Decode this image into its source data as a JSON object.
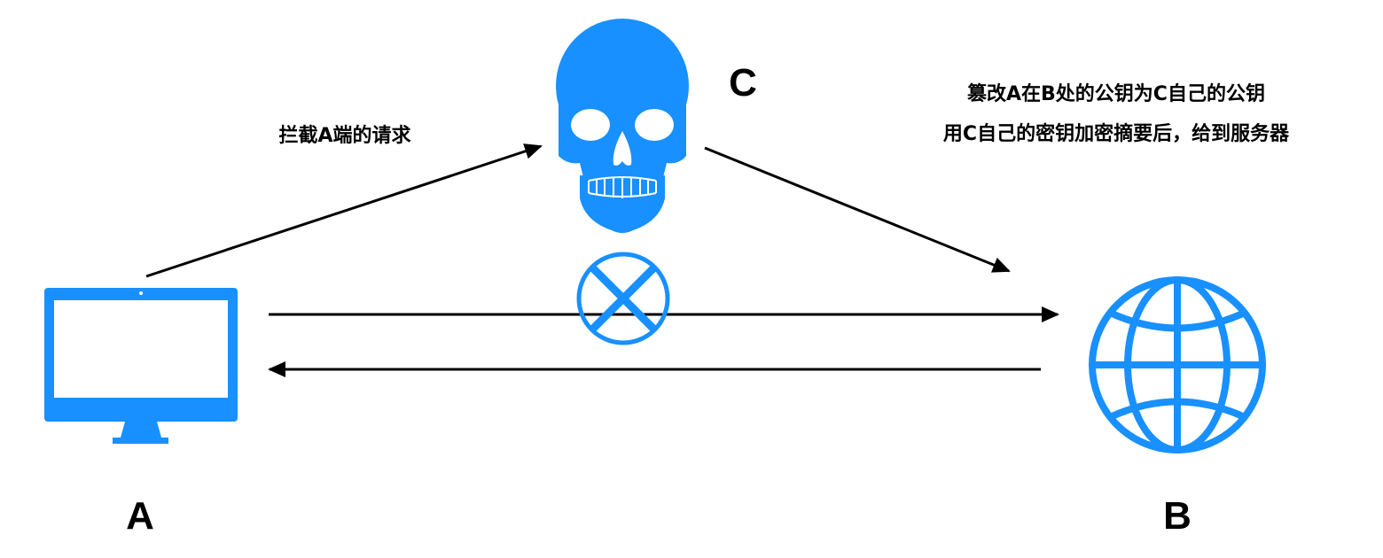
{
  "colors": {
    "icon": "#1890ff",
    "line": "#000000",
    "background": "#ffffff"
  },
  "nodes": {
    "client": {
      "label": "A",
      "icon": "monitor-icon"
    },
    "server": {
      "label": "B",
      "icon": "globe-icon"
    },
    "attacker": {
      "label": "C",
      "icon": "skull-icon"
    }
  },
  "edges": {
    "intercept": {
      "text": "拦截A端的请求"
    },
    "forward": {
      "line1": "篡改A在B处的公钥为C自己的公钥",
      "line2": "用C自己的密钥加密摘要后，给到服务器"
    },
    "direct_blocked_icon": "blocked-x-icon"
  }
}
